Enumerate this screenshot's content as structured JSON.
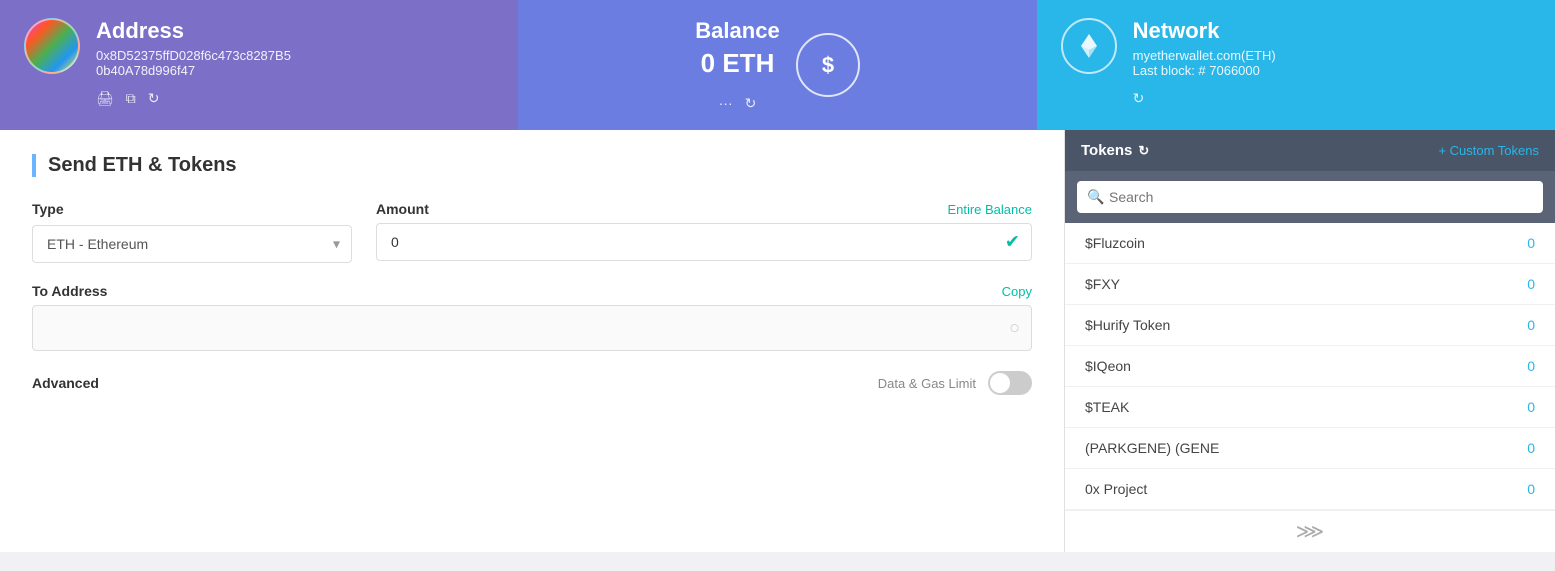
{
  "address_card": {
    "title": "Address",
    "address_line1": "0x8D52375ffD028f6c473c8287B5",
    "address_line2": "0b40A78d996f47",
    "icons": [
      "print-icon",
      "copy-icon",
      "refresh-icon"
    ]
  },
  "balance_card": {
    "title": "Balance",
    "amount": "0",
    "currency": "ETH"
  },
  "network_card": {
    "title": "Network",
    "network_name": "myetherwallet.com(ETH)",
    "last_block": "Last block: # 7066000"
  },
  "send_panel": {
    "title": "Send ETH & Tokens",
    "type_label": "Type",
    "type_value": "ETH - Ethereum",
    "amount_label": "Amount",
    "amount_placeholder": "0",
    "entire_balance": "Entire Balance",
    "to_address_label": "To Address",
    "copy_label": "Copy",
    "to_address_placeholder": "",
    "advanced_label": "Advanced",
    "gas_limit_label": "Data & Gas Limit"
  },
  "tokens_panel": {
    "title": "Tokens",
    "custom_tokens_label": "+ Custom Tokens",
    "search_placeholder": "Search",
    "tokens": [
      {
        "name": "$Fluzcoin",
        "amount": "0"
      },
      {
        "name": "$FXY",
        "amount": "0"
      },
      {
        "name": "$Hurify Token",
        "amount": "0"
      },
      {
        "name": "$IQeon",
        "amount": "0"
      },
      {
        "name": "$TEAK",
        "amount": "0"
      },
      {
        "name": "(PARKGENE) (GENE",
        "amount": "0"
      },
      {
        "name": "0x Project",
        "amount": "0"
      }
    ]
  },
  "colors": {
    "address_card_bg": "#7b6fc7",
    "balance_card_bg": "#6b7de0",
    "network_card_bg": "#29b6e8",
    "tokens_header_bg": "#4a5568",
    "teal": "#00bfa5",
    "blue": "#29b6e8"
  }
}
